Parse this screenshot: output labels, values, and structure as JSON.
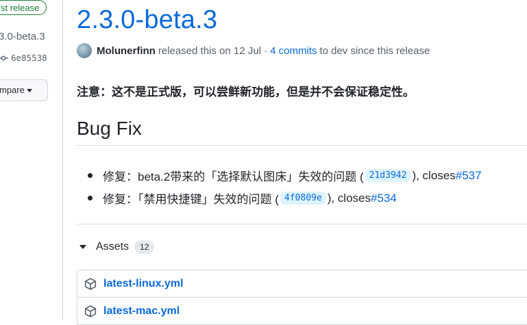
{
  "sidebar": {
    "badge": "Latest release",
    "badge_visible": "st release",
    "tag": "3.0-beta.3",
    "commit": "6e85538",
    "compare_label": "mpare"
  },
  "release": {
    "title": "2.3.0-beta.3",
    "author": "Molunerfinn",
    "released_text": "released this on 12 Jul ·",
    "commits_link": "4 commits",
    "since_text": "to dev since this release",
    "notice": "注意：这不是正式版，可以尝鲜新功能，但是并不会保证稳定性。",
    "section_heading": "Bug Fix",
    "fixes": [
      {
        "text": "修复：beta.2带来的「选择默认图床」失效的问题 (",
        "hash": "21d3942",
        "closes": "), closes ",
        "issue": "#537"
      },
      {
        "text": "修复：「禁用快捷键」失效的问题 (",
        "hash": "4f0809e",
        "closes": "), closes ",
        "issue": "#534"
      }
    ]
  },
  "assets": {
    "label": "Assets",
    "count": "12",
    "files": [
      {
        "name": "latest-linux.yml",
        "icon": "package-icon"
      },
      {
        "name": "latest-mac.yml",
        "icon": "package-icon"
      }
    ]
  },
  "colors": {
    "link": "#0969da",
    "latest_green": "#1a7f37",
    "hash_bg": "#ddf4ff"
  }
}
